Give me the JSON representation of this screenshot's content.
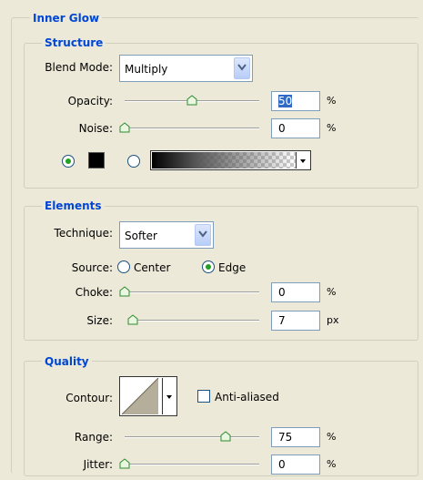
{
  "panel": {
    "title": "Inner Glow"
  },
  "structure": {
    "title": "Structure",
    "blend_mode_label": "Blend Mode:",
    "blend_mode_value": "Multiply",
    "opacity_label": "Opacity:",
    "opacity_value": "50",
    "opacity_unit": "%",
    "opacity_level": 0.5,
    "noise_label": "Noise:",
    "noise_value": "0",
    "noise_unit": "%",
    "noise_level": 0.0,
    "glow_color": "#000000",
    "gradient_selected": false
  },
  "elements": {
    "title": "Elements",
    "technique_label": "Technique:",
    "technique_value": "Softer",
    "source_label": "Source:",
    "source_options": [
      "Center",
      "Edge"
    ],
    "source_selected": "Edge",
    "choke_label": "Choke:",
    "choke_value": "0",
    "choke_unit": "%",
    "choke_level": 0.0,
    "size_label": "Size:",
    "size_value": "7",
    "size_unit": "px",
    "size_level": 0.03
  },
  "quality": {
    "title": "Quality",
    "contour_label": "Contour:",
    "anti_aliased_label": "Anti-aliased",
    "anti_aliased_checked": false,
    "range_label": "Range:",
    "range_value": "75",
    "range_unit": "%",
    "range_level": 0.75,
    "jitter_label": "Jitter:",
    "jitter_value": "0",
    "jitter_unit": "%",
    "jitter_level": 0.0
  },
  "colors": {
    "group_title": "#0046d5",
    "radio_dot": "#21a121",
    "selection": "#316ac5"
  }
}
